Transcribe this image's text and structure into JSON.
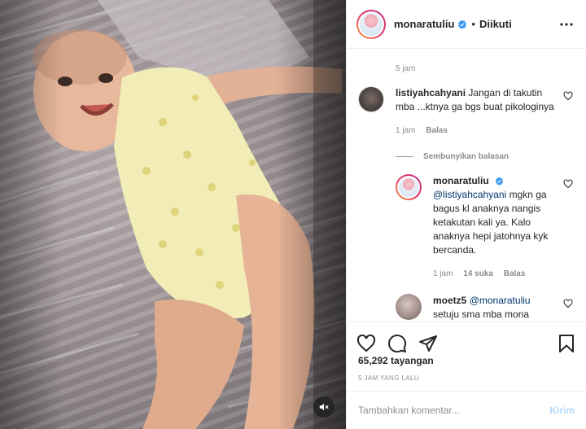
{
  "post": {
    "username": "monaratuliu",
    "follow_status": "Diikuti",
    "separator": "•",
    "previous_comment_time": "5 jam",
    "views_count": "65,292",
    "views_label": "tayangan",
    "posted_ago": "5 JAM YANG LALU"
  },
  "comments": [
    {
      "user": "listiyahcahyani",
      "text": "Jangan di takutin mba ...ktnya ga bgs buat pikologinya",
      "time": "1 jam",
      "reply_label": "Balas",
      "hide_replies_label": "Sembunyikan balasan"
    }
  ],
  "replies": [
    {
      "user": "monaratuliu",
      "mention": "@listiyahcahyani",
      "text": "mgkn ga bagus kl anaknya nangis ketakutan kali ya. Kalo anaknya hepi jatohnya kyk bercanda.",
      "time": "1 jam",
      "likes": "14 suka",
      "reply_label": "Balas"
    },
    {
      "user": "moetz5",
      "mention": "@monaratuliu",
      "text": "setuju sma mba mona"
    }
  ],
  "composer": {
    "placeholder": "Tambahkan komentar...",
    "post_label": "Kirim"
  },
  "icons": {
    "verified": "verified-badge-icon",
    "more": "more-options-icon",
    "like": "heart-icon",
    "comment": "comment-icon",
    "share": "share-icon",
    "save": "bookmark-icon",
    "mute": "speaker-muted-icon"
  },
  "colors": {
    "verified": "#3897f0",
    "link": "#00376b",
    "secondary_text": "#8e8e8e",
    "post_button": "#b3dbff"
  }
}
